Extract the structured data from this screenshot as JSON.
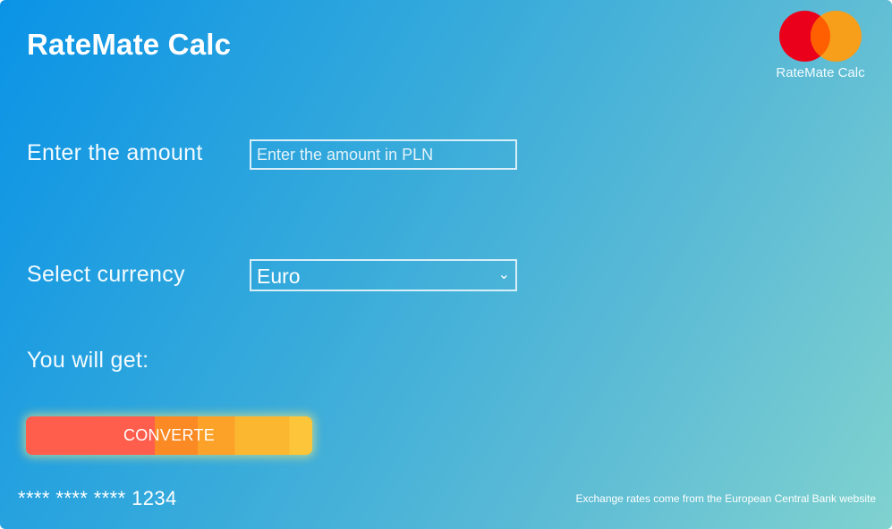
{
  "header": {
    "title": "RateMate Calc"
  },
  "logo": {
    "caption": "RateMate Calc",
    "colors": {
      "left_circle": "#eb001b",
      "right_circle": "#f79e1b",
      "overlap": "#ff5f00"
    }
  },
  "form": {
    "amount_label": "Enter the amount",
    "amount_value": "",
    "amount_placeholder": "Enter the amount in PLN",
    "currency_label": "Select currency",
    "currency_selected": "Euro",
    "result_label": "You will get:"
  },
  "actions": {
    "convert_label": "CONVERTE"
  },
  "card": {
    "number_masked": "**** **** **** 1234"
  },
  "footer": {
    "note": "Exchange rates come from the European Central Bank website"
  },
  "icons": {
    "select_chevron": "chevron-down-icon"
  },
  "theme": {
    "gradient_start": "#0a93e6",
    "gradient_end": "#80d2cf",
    "button_red": "#ff5e4d",
    "button_yellow": "#fbb730"
  }
}
